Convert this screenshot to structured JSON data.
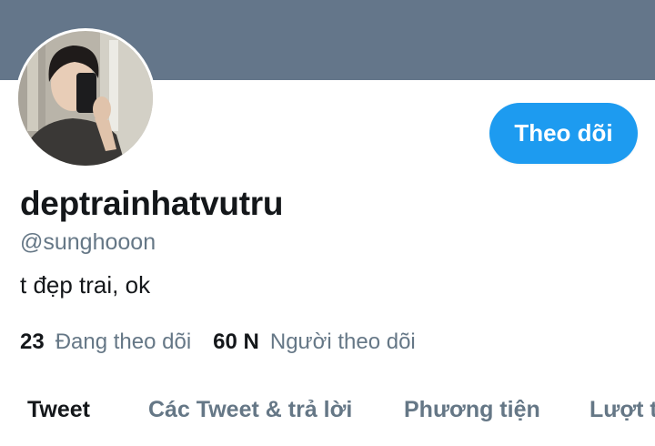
{
  "profile": {
    "display_name": "deptrainhatvutru",
    "handle": "@sunghooon",
    "bio": "t đẹp trai, ok"
  },
  "actions": {
    "follow_label": "Theo dõi"
  },
  "stats": {
    "following_count": "23",
    "following_label": "Đang theo dõi",
    "followers_count": "60 N",
    "followers_label": "Người theo dõi"
  },
  "tabs": [
    {
      "label": "Tweet"
    },
    {
      "label": "Các Tweet & trả lời"
    },
    {
      "label": "Phương tiện"
    },
    {
      "label": "Lượt thích"
    }
  ],
  "colors": {
    "banner": "#64768a",
    "accent": "#1d9bf0",
    "text_primary": "#14171a",
    "text_secondary": "#657786"
  }
}
